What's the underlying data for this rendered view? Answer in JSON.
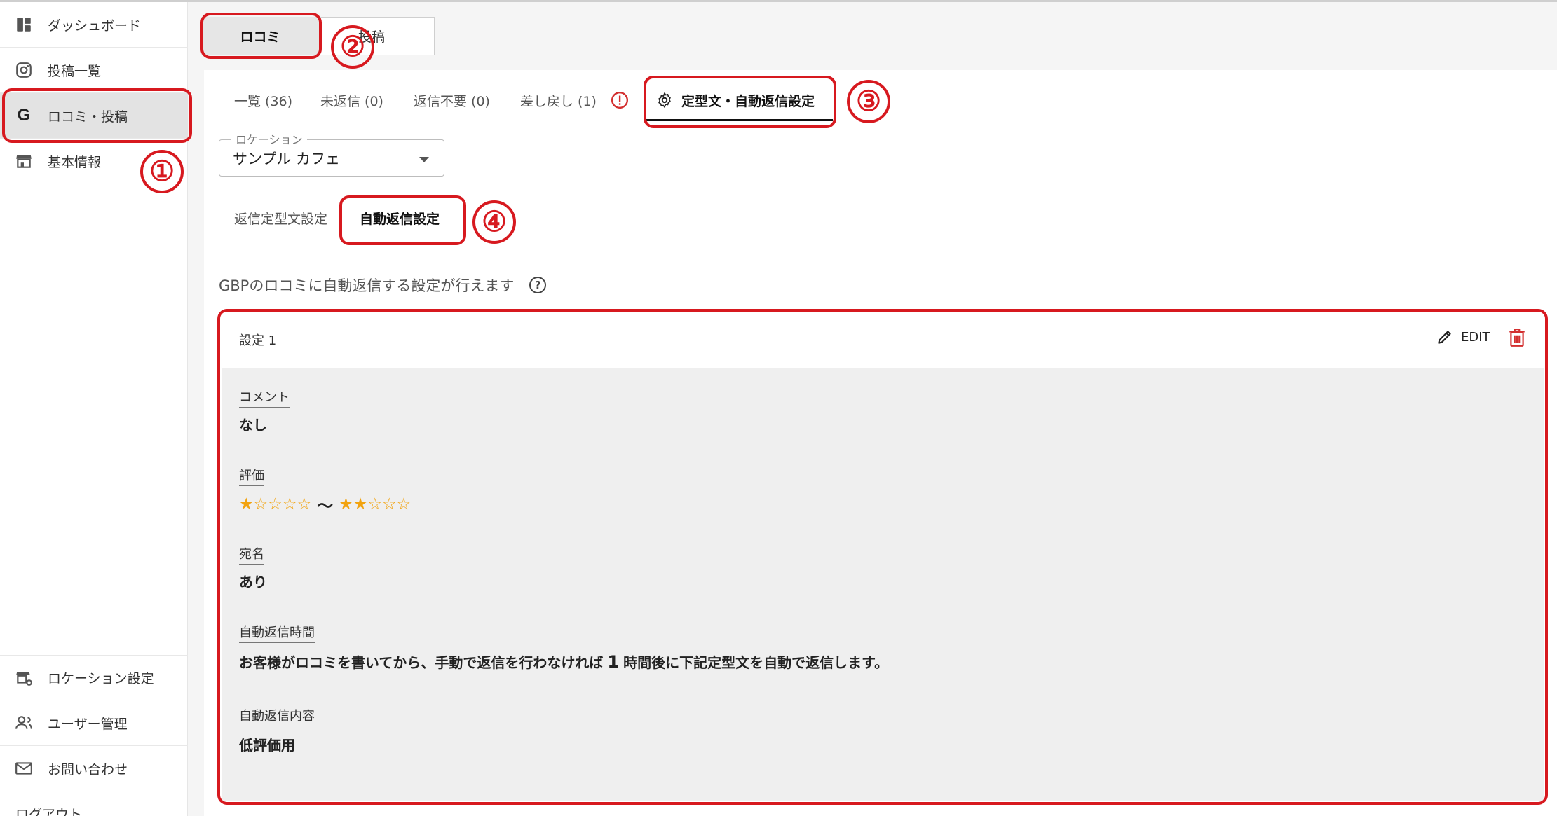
{
  "sidebar": {
    "items": [
      {
        "label": "ダッシュボード",
        "icon": "dashboard-icon"
      },
      {
        "label": "投稿一覧",
        "icon": "instagram-icon"
      },
      {
        "label": "ロコミ・投稿",
        "icon": "google-icon"
      },
      {
        "label": "基本情報",
        "icon": "store-icon"
      }
    ],
    "bottom_items": [
      {
        "label": "ロケーション設定",
        "icon": "location-settings-icon"
      },
      {
        "label": "ユーザー管理",
        "icon": "user-manage-icon"
      },
      {
        "label": "お問い合わせ",
        "icon": "mail-icon"
      },
      {
        "label": "ログアウト",
        "icon": "logout-icon"
      }
    ]
  },
  "top_tabs": [
    {
      "label": "ロコミ"
    },
    {
      "label": "投稿"
    }
  ],
  "sub_tabs": [
    {
      "label": "一覧 (36)"
    },
    {
      "label": "未返信 (0)"
    },
    {
      "label": "返信不要 (0)"
    },
    {
      "label": "差し戻し (1)"
    },
    {
      "label": "定型文・自動返信設定"
    }
  ],
  "location": {
    "label": "ロケーション",
    "value": "サンプル カフェ"
  },
  "mode_tabs": [
    {
      "label": "返信定型文設定"
    },
    {
      "label": "自動返信設定"
    }
  ],
  "description": "GBPのロコミに自動返信する設定が行えます",
  "help_glyph": "?",
  "card": {
    "title": "設定 1",
    "edit_label": "EDIT",
    "fields": {
      "comment_label": "コメント",
      "comment_value": "なし",
      "rating_label": "評価",
      "rating_from": 1,
      "rating_to": 2,
      "rating_max": 5,
      "rating_range_separator": "〜",
      "addressee_label": "宛名",
      "addressee_value": "あり",
      "time_label": "自動返信時間",
      "time_before": "お客様がロコミを書いてから、手動で返信を行わなければ",
      "time_hours": "1",
      "time_after": "時間後に下記定型文を自動で返信します。",
      "content_label": "自動返信内容",
      "content_value": "低評価用"
    }
  },
  "annotations": [
    "①",
    "②",
    "③",
    "④"
  ],
  "colors": {
    "highlight": "#d7191f",
    "star": "#f2a30f",
    "warning": "#d32f2f"
  }
}
